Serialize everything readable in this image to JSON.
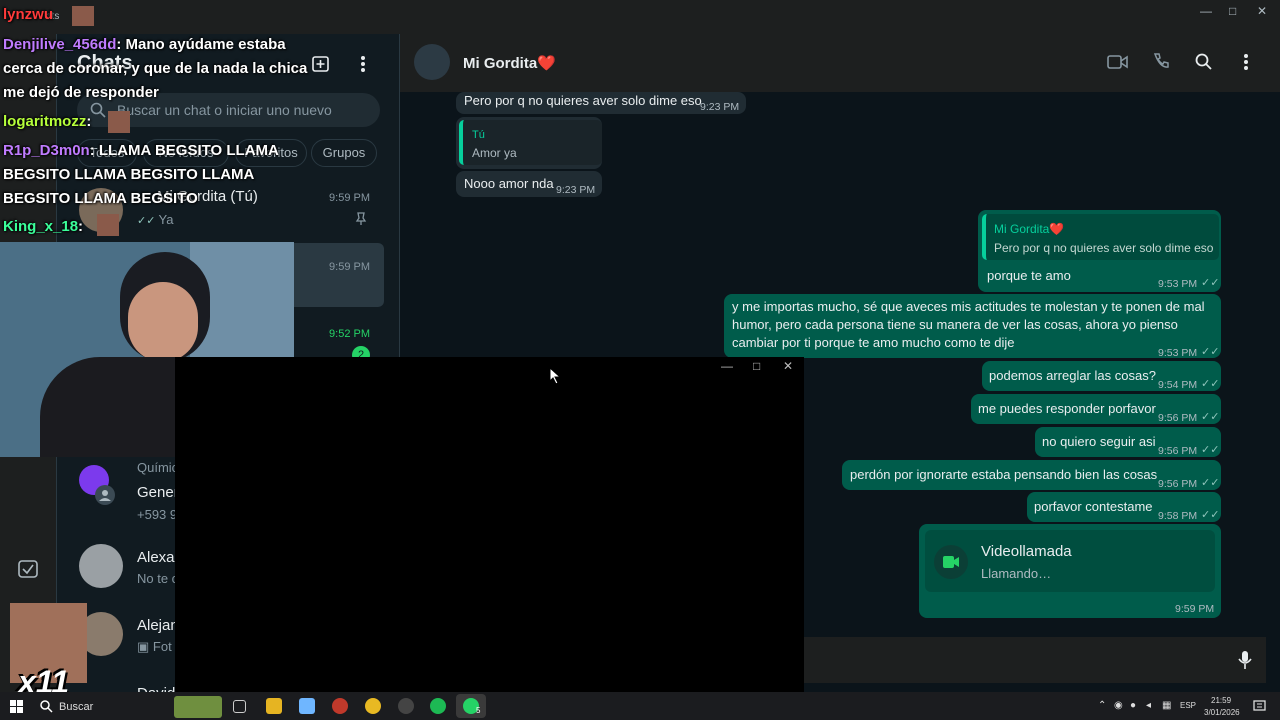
{
  "titlebar": {
    "app_label": "ats",
    "minimize": "—",
    "maximize": "□",
    "close": "✕"
  },
  "sidebar": {
    "title": "Chats",
    "search_placeholder": "Buscar un chat o iniciar uno nuevo",
    "filters": [
      "Todos",
      "No leídos",
      "Favoritos",
      "Grupos"
    ],
    "chats": [
      {
        "name": "Mi Gordita (Tú)",
        "preview": "Ya",
        "time": "9:59 PM"
      },
      {
        "name": "",
        "preview": "",
        "time": "9:59 PM"
      },
      {
        "name": "",
        "preview": "...",
        "time": "9:52 PM",
        "unread": "2"
      },
      {
        "group_prefix": "Químic",
        "name": "Gener",
        "preview": "+593 9"
      },
      {
        "name": "Alexan",
        "preview": "No te c"
      },
      {
        "name": "Alejan",
        "preview": "Fot"
      },
      {
        "name": "David"
      }
    ]
  },
  "conversation": {
    "contact_name": "Mi Gordita❤️",
    "messages_in": [
      {
        "text": "Pero por q no quieres aver solo dime eso",
        "time": "9:23 PM"
      },
      {
        "quote_author": "Tú",
        "quote_text": "Amor ya"
      },
      {
        "text": "Nooo amor nda",
        "time": "9:23 PM"
      }
    ],
    "messages_out": [
      {
        "quote_author": "Mi Gordita❤️",
        "quote_text": "Pero por q no quieres aver solo dime eso",
        "text": "porque te amo",
        "time": "9:53 PM"
      },
      {
        "text": "y me importas mucho, sé que aveces mis actitudes te molestan y te ponen de mal humor, pero cada persona tiene su manera de ver las cosas, ahora yo pienso cambiar por ti porque te amo mucho como te dije",
        "time": "9:53 PM"
      },
      {
        "text": "podemos arreglar las cosas?",
        "time": "9:54 PM"
      },
      {
        "text": "me puedes responder porfavor",
        "time": "9:56 PM"
      },
      {
        "text": "no quiero seguir asi",
        "time": "9:56 PM"
      },
      {
        "text": "perdón por ignorarte estaba pensando bien las cosas",
        "time": "9:56 PM"
      },
      {
        "text": "porfavor contestame",
        "time": "9:58 PM"
      }
    ],
    "call": {
      "title": "Videollamada",
      "status": "Llamando…",
      "time": "9:59 PM"
    }
  },
  "stream_chat": [
    {
      "user": "lynzwu",
      "text": ""
    },
    {
      "user": "Denjilive_456dd",
      "text": ": Mano ayúdame estaba"
    },
    {
      "user": "",
      "text": "cerca de coronar, y que de la nada la chica"
    },
    {
      "user": "",
      "text": "me dejó de responder"
    },
    {
      "user": "logaritmozz",
      "text": ":"
    },
    {
      "user": "R1p_D3m0n",
      "text": ": LLAMA BEGSITO LLAMA"
    },
    {
      "user": "",
      "text": "BEGSITO LLAMA BEGSITO LLAMA"
    },
    {
      "user": "",
      "text": "BEGSITO LLAMA BEGSITO"
    },
    {
      "user": "King_x_18",
      "text": ":"
    }
  ],
  "emote_label": "x11",
  "taskbar": {
    "search_label": "Buscar",
    "lang": "ESP",
    "time": "21:59",
    "date": "3/01/2026",
    "whatsapp_badge": "5"
  },
  "colors": {
    "outgoing": "#005c4b",
    "incoming": "#202c33",
    "accent": "#00a884"
  }
}
